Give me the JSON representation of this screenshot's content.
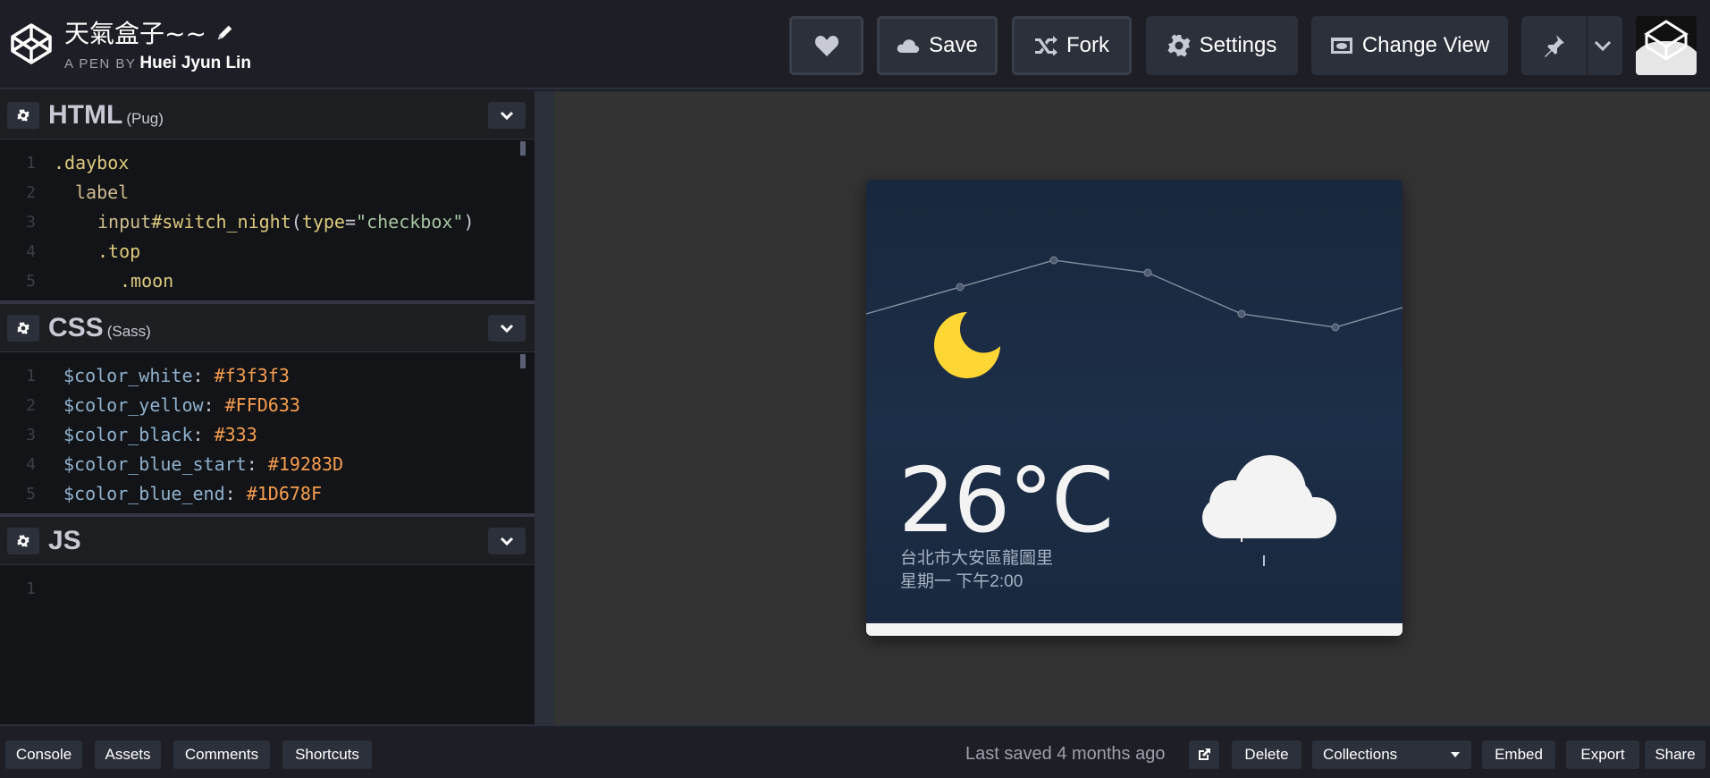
{
  "header": {
    "title": "天氣盒子~~",
    "byline_prefix": "A PEN BY",
    "author": "Huei Jyun Lin",
    "buttons": {
      "save": "Save",
      "fork": "Fork",
      "settings": "Settings",
      "change_view": "Change View"
    }
  },
  "editors": {
    "html": {
      "name": "HTML",
      "preprocessor": "(Pug)",
      "lines": [
        "1",
        "2",
        "3",
        "4",
        "5"
      ]
    },
    "css": {
      "name": "CSS",
      "preprocessor": "(Sass)",
      "lines": [
        "1",
        "2",
        "3",
        "4",
        "5"
      ]
    },
    "js": {
      "name": "JS",
      "lines": [
        "1"
      ]
    }
  },
  "code": {
    "html_l1": ".daybox",
    "html_l2": "label",
    "html_l3_tag": "input",
    "html_l3_id": "#switch_night",
    "html_l3_open": "(",
    "html_l3_attr": "type",
    "html_l3_eq": "=",
    "html_l3_str": "\"checkbox\"",
    "html_l3_close": ")",
    "html_l4": ".top",
    "html_l5": ".moon",
    "css_vars": [
      {
        "name": "$color_white",
        "value": "#f3f3f3"
      },
      {
        "name": "$color_yellow",
        "value": "#FFD633"
      },
      {
        "name": "$color_black",
        "value": "#333"
      },
      {
        "name": "$color_blue_start",
        "value": "#19283D"
      },
      {
        "name": "$color_blue_end",
        "value": "#1D678F"
      }
    ],
    "colon": ":"
  },
  "preview": {
    "temperature": "26°C",
    "location": "台北市大安區龍圖里",
    "datetime": "星期一 下午2:00"
  },
  "footer": {
    "console": "Console",
    "assets": "Assets",
    "comments": "Comments",
    "shortcuts": "Shortcuts",
    "last_saved": "Last saved 4 months ago",
    "delete": "Delete",
    "collections": "Collections",
    "embed": "Embed",
    "export": "Export",
    "share": "Share"
  },
  "colors": {
    "moon": "#FFD633",
    "cloud": "#f3f3f3",
    "sky_top": "#19283D"
  }
}
